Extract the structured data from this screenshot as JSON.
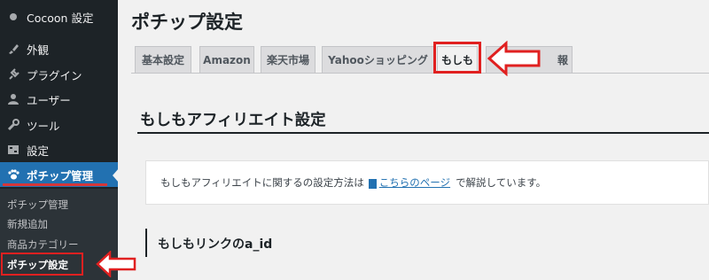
{
  "sidebar": {
    "items": [
      {
        "label": "Cocoon 設定",
        "icon": "cocoon-icon"
      },
      {
        "label": "外観",
        "icon": "paintbrush-icon"
      },
      {
        "label": "プラグイン",
        "icon": "plugin-icon"
      },
      {
        "label": "ユーザー",
        "icon": "user-icon"
      },
      {
        "label": "ツール",
        "icon": "wrench-icon"
      },
      {
        "label": "設定",
        "icon": "settings-icon"
      },
      {
        "label": "ポチップ管理",
        "icon": "paw-icon"
      }
    ],
    "submenu": [
      {
        "label": "ポチップ管理"
      },
      {
        "label": "新規追加"
      },
      {
        "label": "商品カテゴリー"
      },
      {
        "label": "ポチップ設定"
      }
    ]
  },
  "page": {
    "title": "ポチップ設定",
    "tabs": [
      {
        "label": "基本設定"
      },
      {
        "label": "Amazon"
      },
      {
        "label": "楽天市場"
      },
      {
        "label": "Yahooショッピング"
      },
      {
        "label": "もしも"
      },
      {
        "label": "報"
      }
    ],
    "section_heading": "もしもアフィリエイト設定",
    "notice": {
      "prefix": "もしもアフィリエイトに関するの設定方法は",
      "link": "こちらのページ",
      "suffix": "で解説しています。"
    },
    "sub_heading": "もしもリンクのa_id"
  },
  "colors": {
    "sidebar_bg": "#1d2327",
    "accent": "#2271b1",
    "highlight_red": "#e02020"
  }
}
